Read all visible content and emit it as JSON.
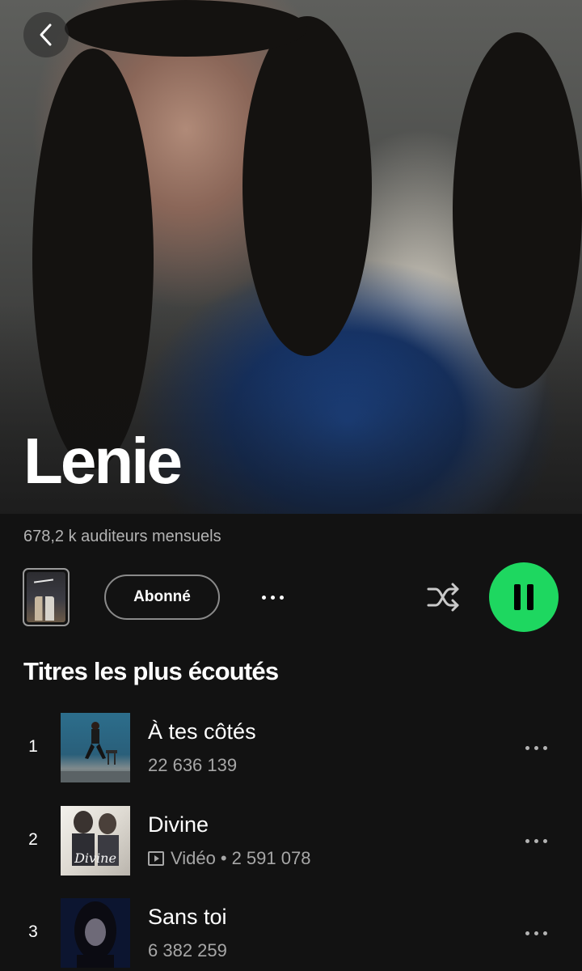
{
  "artist": {
    "name": "Lenie",
    "monthly_listeners": "678,2 k auditeurs mensuels"
  },
  "actions": {
    "follow_label": "Abonné",
    "more_icon": "more-horizontal-icon",
    "shuffle_icon": "shuffle-icon",
    "play_state": "playing",
    "accent_color": "#1ed760"
  },
  "section": {
    "title": "Titres les plus écoutés"
  },
  "tracks": [
    {
      "rank": "1",
      "title": "À tes côtés",
      "meta": "22 636 139"
    },
    {
      "rank": "2",
      "title": "Divine",
      "video_label": "Vidéo",
      "meta": "2 591 078"
    },
    {
      "rank": "3",
      "title": "Sans toi",
      "meta": "6 382 259"
    }
  ]
}
